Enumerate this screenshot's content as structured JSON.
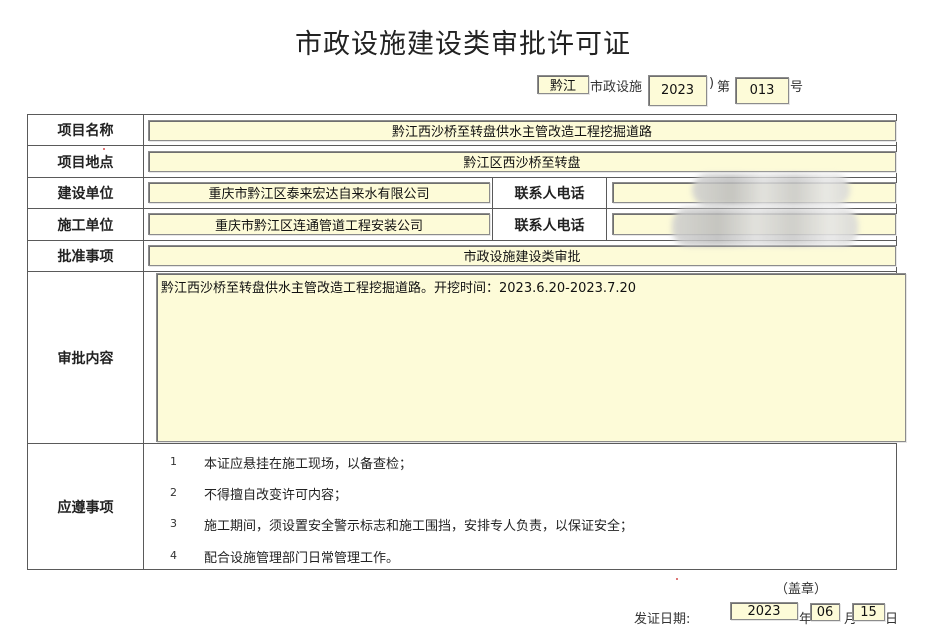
{
  "title": "市政设施建设类审批许可证",
  "ref": {
    "district": "黔江",
    "mid_text": "市政设施",
    "year": "2023",
    "bracket": ")",
    "di": "第",
    "number": "013",
    "hao": "号"
  },
  "fields": {
    "project_name_label": "项目名称",
    "project_name": "黔江西沙桥至转盘供水主管改造工程挖掘道路",
    "project_site_label": "项目地点",
    "project_site": "黔江区西沙桥至转盘",
    "builder_label": "建设单位",
    "builder": "重庆市黔江区泰来宏达自来水有限公司",
    "builder_contact_label": "联系人电话",
    "builder_contact": "",
    "contractor_label": "施工单位",
    "contractor": "重庆市黔江区连通管道工程安装公司",
    "contractor_contact_label": "联系人电话",
    "contractor_contact": "",
    "approval_item_label": "批准事项",
    "approval_item": "市政设施建设类审批",
    "approval_content_label": "审批内容",
    "approval_content": "黔江西沙桥至转盘供水主管改造工程挖掘道路。开挖时间：2023.6.20-2023.7.20",
    "notes_label": "应遵事项"
  },
  "notes": [
    {
      "num": "1",
      "text": "本证应悬挂在施工现场，以备查检；"
    },
    {
      "num": "2",
      "text": "不得擅自改变许可内容；"
    },
    {
      "num": "3",
      "text": "施工期间，须设置安全警示标志和施工围挡，安排专人负责，以保证安全；"
    },
    {
      "num": "4",
      "text": "配合设施管理部门日常管理工作。"
    }
  ],
  "footer": {
    "seal": "（盖章）",
    "issue_date_label": "发证日期:",
    "year": "2023",
    "year_char": "年",
    "month": "06",
    "month_char": "月",
    "day": "15",
    "day_char": "日"
  }
}
